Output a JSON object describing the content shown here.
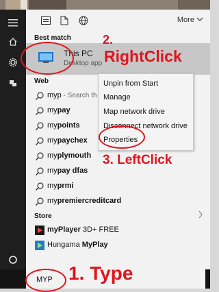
{
  "header": {
    "more_label": "More",
    "icons": [
      "document-view-icon",
      "new-doc-icon",
      "globe-icon",
      "chevron-down-icon"
    ]
  },
  "sidebar": {
    "icons": [
      "hamburger-icon",
      "home-icon",
      "settings-icon",
      "user-icon",
      "cortana-circle-icon",
      "windows-logo-icon"
    ]
  },
  "best_match": {
    "label": "Best match",
    "title": "This PC",
    "subtitle": "Desktop app"
  },
  "web": {
    "label": "Web",
    "items": [
      {
        "prefix": "",
        "bold": "",
        "text": "myp",
        "hint": " - Search th"
      },
      {
        "prefix": "my",
        "bold": "pay",
        "text": "",
        "hint": ""
      },
      {
        "prefix": "my",
        "bold": "points",
        "text": "",
        "hint": ""
      },
      {
        "prefix": "my",
        "bold": "paychex",
        "text": "",
        "hint": ""
      },
      {
        "prefix": "my",
        "bold": "plymouth",
        "text": "",
        "hint": ""
      },
      {
        "prefix": "my",
        "bold": "pay dfas",
        "text": "",
        "hint": ""
      },
      {
        "prefix": "my",
        "bold": "prmi",
        "text": "",
        "hint": ""
      },
      {
        "prefix": "my",
        "bold": "premiercreditcard",
        "text": "",
        "hint": ""
      }
    ]
  },
  "store": {
    "label": "Store",
    "items": [
      {
        "prefix": "",
        "bold": "myPlayer",
        "rest": " 3D+ FREE"
      },
      {
        "prefix": "Hungama ",
        "bold": "MyPlay",
        "rest": ""
      }
    ]
  },
  "context_menu": {
    "items": [
      "Unpin from Start",
      "Manage",
      "Map network drive",
      "Disconnect network drive",
      "Properties"
    ]
  },
  "search": {
    "value": "MYP"
  },
  "annotations": {
    "step1": "1. Type",
    "step2": "2.",
    "step2_action": "RightClick",
    "step3": "3. LeftClick",
    "color": "#e0141d"
  },
  "colors": {
    "rail": "#1e1e1e",
    "panel": "#f2f2f2",
    "selected_row": "#c7c7c7",
    "accent_blue": "#1e73c8"
  }
}
